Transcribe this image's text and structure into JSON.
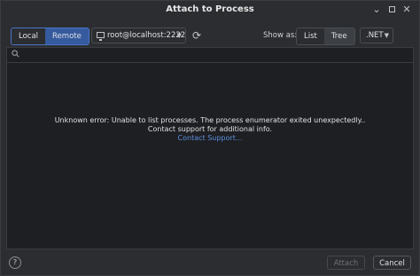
{
  "window": {
    "title": "Attach to Process",
    "minimize_glyph": "⌄",
    "close_glyph": "✕"
  },
  "toolbar": {
    "mode_options": [
      "Local",
      "Remote"
    ],
    "selected_mode": "Remote",
    "host": "root@localhost:2222",
    "refresh_glyph": "⟳",
    "show_as_label": "Show as:",
    "view_options": [
      "List",
      "Tree"
    ],
    "selected_view": "Tree",
    "runtime": ".NET",
    "caret_glyph": "▼"
  },
  "search": {
    "icon": "search-icon",
    "placeholder": ""
  },
  "message": {
    "line1": "Unknown error: Unable to list processes. The process enumerator exited unexpectedly..",
    "line2": "Contact support for additional info.",
    "link": "Contact Support..."
  },
  "footer": {
    "help": "?",
    "attach_label": "Attach",
    "cancel_label": "Cancel"
  },
  "colors": {
    "background": "#2b2d30",
    "panel": "#1e1f22",
    "accent": "#4b76c7",
    "link": "#5a8fe0"
  }
}
